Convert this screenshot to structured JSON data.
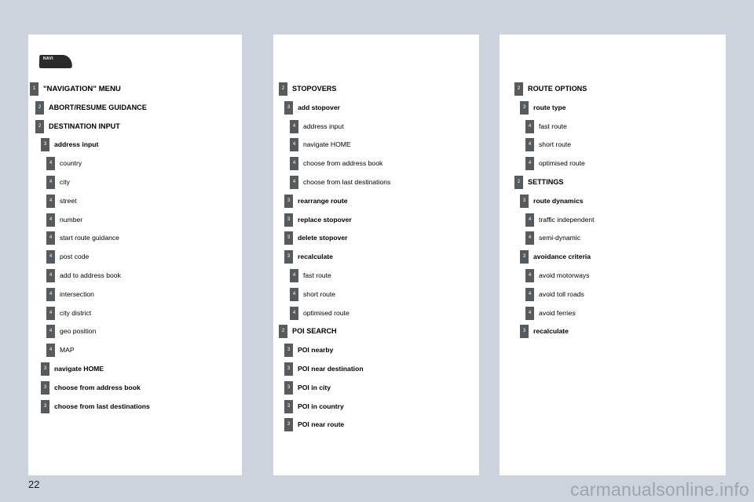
{
  "document": {
    "page_number": "22",
    "watermark": "carmanualsonline.info",
    "logo_text": "NAVI"
  },
  "panels": [
    {
      "id": "panel-1",
      "rows": [
        {
          "level": "1",
          "label": "\"NAVIGATION\" MENU",
          "bold": true
        },
        {
          "level": "2",
          "label": "ABORT/RESUME GUIDANCE",
          "bold": true
        },
        {
          "level": "2",
          "label": "DESTINATION INPUT",
          "bold": true
        },
        {
          "level": "3",
          "label": "address input",
          "bold": true
        },
        {
          "level": "4",
          "label": "country",
          "bold": false
        },
        {
          "level": "4",
          "label": "city",
          "bold": false
        },
        {
          "level": "4",
          "label": "street",
          "bold": false
        },
        {
          "level": "4",
          "label": "number",
          "bold": false
        },
        {
          "level": "4",
          "label": "start route guidance",
          "bold": false
        },
        {
          "level": "4",
          "label": "post code",
          "bold": false
        },
        {
          "level": "4",
          "label": "add to address book",
          "bold": false
        },
        {
          "level": "4",
          "label": "intersection",
          "bold": false
        },
        {
          "level": "4",
          "label": "city district",
          "bold": false
        },
        {
          "level": "4",
          "label": "geo position",
          "bold": false
        },
        {
          "level": "4",
          "label": "MAP",
          "bold": false
        },
        {
          "level": "3",
          "label": "navigate HOME",
          "bold": true
        },
        {
          "level": "3",
          "label": "choose from address book",
          "bold": true
        },
        {
          "level": "3",
          "label": "choose from last destinations",
          "bold": true
        }
      ]
    },
    {
      "id": "panel-2",
      "rows": [
        {
          "level": "2",
          "label": "STOPOVERS",
          "bold": true
        },
        {
          "level": "3",
          "label": "add stopover",
          "bold": true
        },
        {
          "level": "4",
          "label": "address input",
          "bold": false
        },
        {
          "level": "4",
          "label": "navigate HOME",
          "bold": false
        },
        {
          "level": "4",
          "label": "choose from address book",
          "bold": false
        },
        {
          "level": "4",
          "label": "choose from last destinations",
          "bold": false
        },
        {
          "level": "3",
          "label": "rearrange route",
          "bold": true
        },
        {
          "level": "3",
          "label": "replace stopover",
          "bold": true
        },
        {
          "level": "3",
          "label": "delete stopover",
          "bold": true
        },
        {
          "level": "3",
          "label": "recalculate",
          "bold": true
        },
        {
          "level": "4",
          "label": "fast route",
          "bold": false
        },
        {
          "level": "4",
          "label": "short route",
          "bold": false
        },
        {
          "level": "4",
          "label": "optimised route",
          "bold": false
        },
        {
          "level": "2",
          "label": "POI SEARCH",
          "bold": true
        },
        {
          "level": "3",
          "label": "POI nearby",
          "bold": true
        },
        {
          "level": "3",
          "label": "POI near destination",
          "bold": true
        },
        {
          "level": "3",
          "label": "POI in city",
          "bold": true
        },
        {
          "level": "3",
          "label": "POI in country",
          "bold": true
        },
        {
          "level": "3",
          "label": "POI near route",
          "bold": true
        }
      ]
    },
    {
      "id": "panel-3",
      "rows": [
        {
          "level": "2",
          "label": "ROUTE OPTIONS",
          "bold": true
        },
        {
          "level": "3",
          "label": "route type",
          "bold": true
        },
        {
          "level": "4",
          "label": "fast route",
          "bold": false
        },
        {
          "level": "4",
          "label": "short route",
          "bold": false
        },
        {
          "level": "4",
          "label": "optimised route",
          "bold": false
        },
        {
          "level": "2",
          "label": "SETTINGS",
          "bold": true
        },
        {
          "level": "3",
          "label": "route dynamics",
          "bold": true
        },
        {
          "level": "4",
          "label": "traffic independent",
          "bold": false
        },
        {
          "level": "4",
          "label": "semi-dynamic",
          "bold": false
        },
        {
          "level": "3",
          "label": "avoidance criteria",
          "bold": true
        },
        {
          "level": "4",
          "label": "avoid motorways",
          "bold": false
        },
        {
          "level": "4",
          "label": "avoid toll roads",
          "bold": false
        },
        {
          "level": "4",
          "label": "avoid ferries",
          "bold": false
        },
        {
          "level": "3",
          "label": "recalculate",
          "bold": true
        }
      ]
    }
  ]
}
